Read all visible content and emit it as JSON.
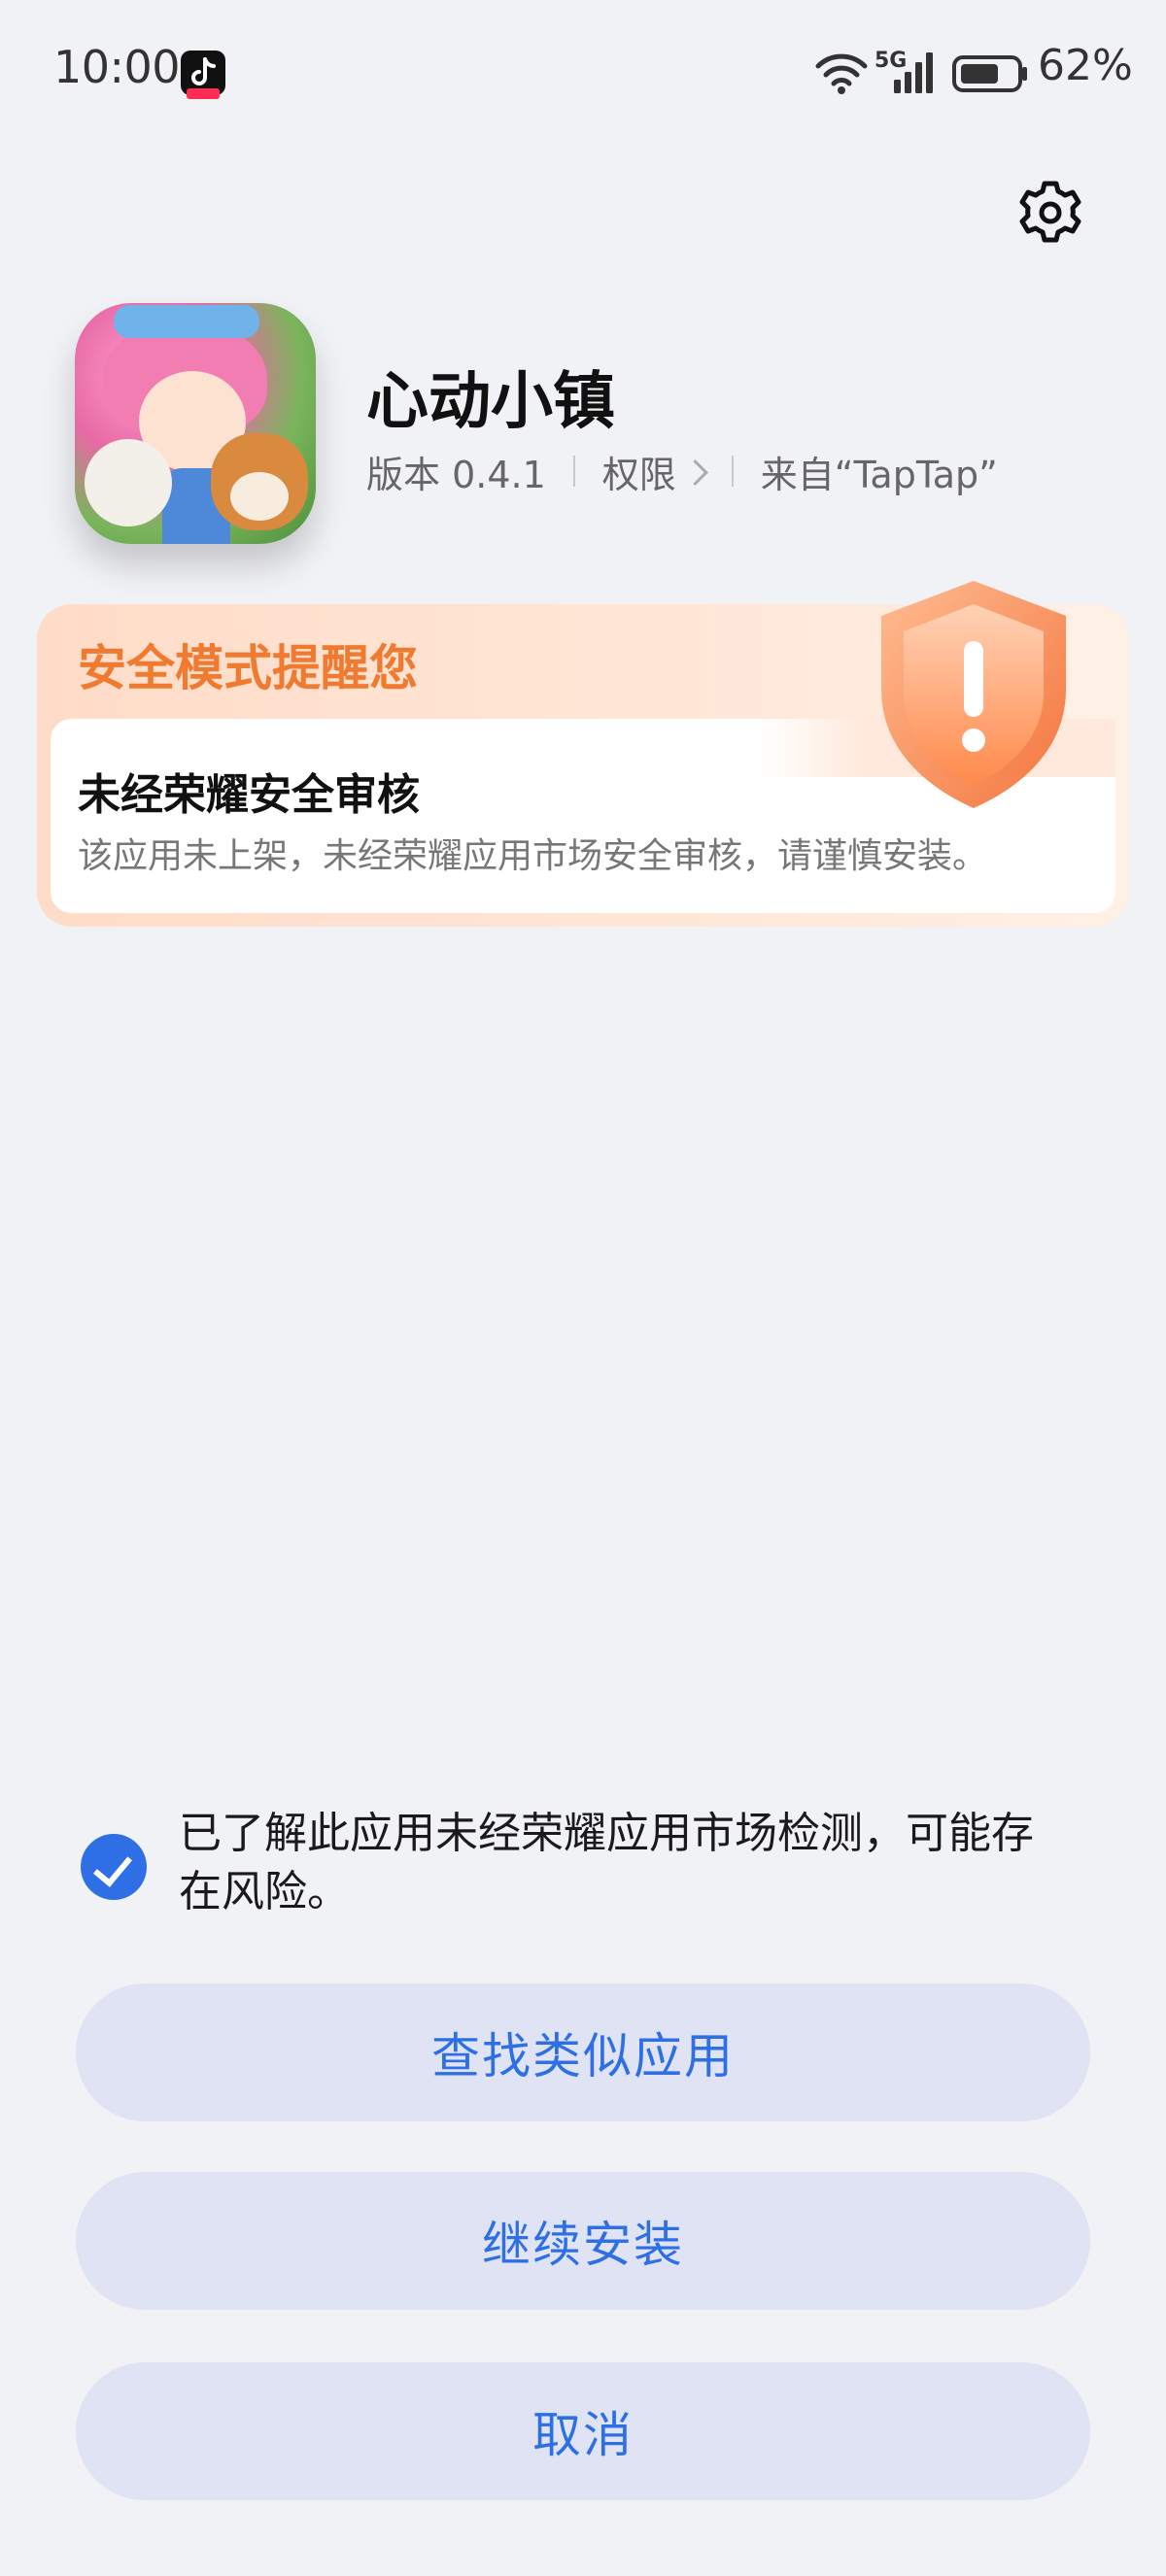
{
  "status_bar": {
    "time": "10:00",
    "network": "5G",
    "battery": "62%",
    "icons": [
      "tiktok-notification-icon",
      "wifi-icon",
      "signal-icon",
      "battery-icon"
    ]
  },
  "header": {
    "settings_icon": "gear-icon"
  },
  "app": {
    "name": "心动小镇",
    "version": "版本 0.4.1",
    "permissions": "权限",
    "source": "来自“TapTap”"
  },
  "warning": {
    "title": "安全模式提醒您",
    "heading": "未经荣耀安全审核",
    "body": "该应用未上架，未经荣耀应用市场安全审核，请谨慎安装。",
    "icon": "warning-shield-icon",
    "accent_color": "#f07a30"
  },
  "acknowledge": {
    "checked": true,
    "text": "已了解此应用未经荣耀应用市场检测，可能存在风险。"
  },
  "buttons": {
    "find_similar": "查找类似应用",
    "continue_install": "继续安装",
    "cancel": "取消",
    "accent_color": "#2e6fe6"
  }
}
